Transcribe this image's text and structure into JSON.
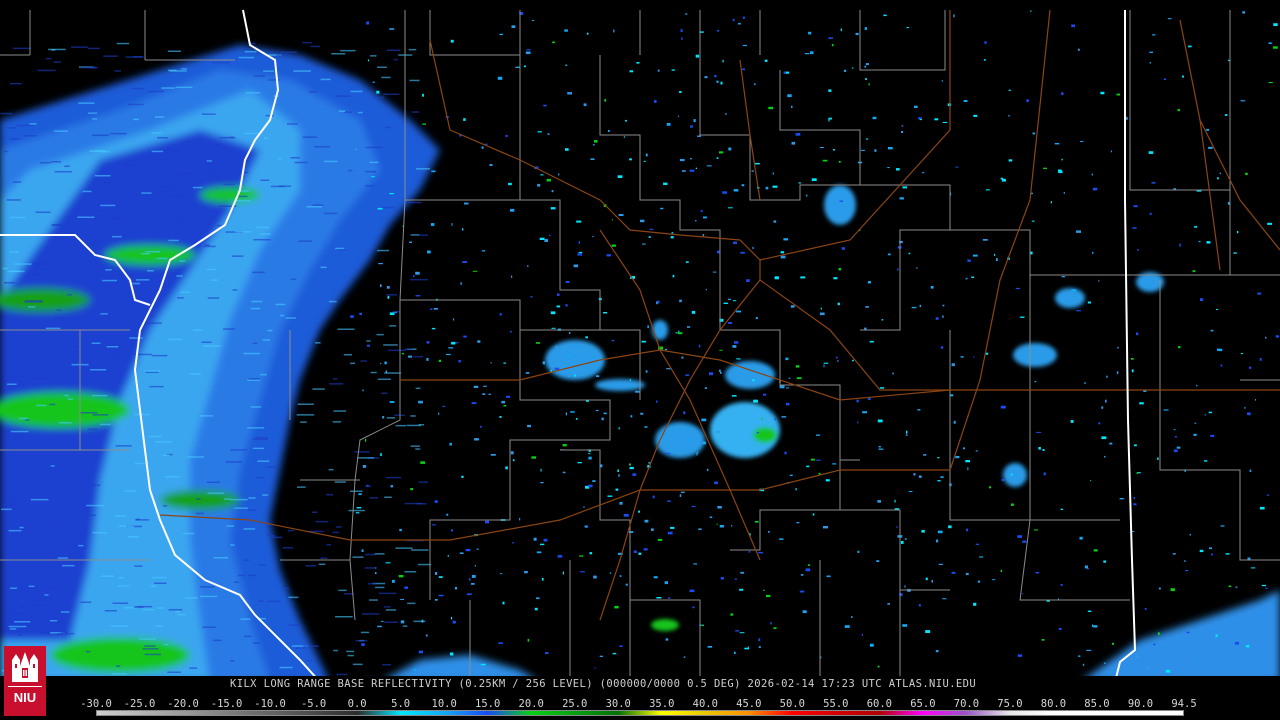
{
  "caption": "KILX LONG RANGE BASE REFLECTIVITY (0.25KM / 256 LEVEL) (000000/0000 0.5 DEG) 2026-02-14 17:23 UTC  ATLAS.NIU.EDU",
  "logo_text": "NIU",
  "scale": {
    "labels": [
      "-30.0",
      "-25.0",
      "-20.0",
      "-15.0",
      "-10.0",
      "-5.0",
      "0.0",
      "5.0",
      "10.0",
      "15.0",
      "20.0",
      "25.0",
      "30.0",
      "35.0",
      "40.0",
      "45.0",
      "50.0",
      "55.0",
      "60.0",
      "65.0",
      "70.0",
      "75.0",
      "80.0",
      "85.0",
      "90.0",
      "94.5"
    ],
    "colors": [
      "#cfcfcf",
      "#b5b5b5",
      "#9a9a9a",
      "#7e7e7e",
      "#646464",
      "#4a4a4a",
      "#2d2d2d",
      "#00e8ff",
      "#14a8f5",
      "#1a4cf2",
      "#08d014",
      "#06a010",
      "#067008",
      "#ffff00",
      "#e8c800",
      "#ff9000",
      "#ff0000",
      "#d40000",
      "#b00000",
      "#ff00ff",
      "#9a55c8",
      "#e6e6e6",
      "#ffffff",
      "#ffffff",
      "#ffffff",
      "#ffffff"
    ]
  },
  "colors": {
    "background": "#000000",
    "county_lines": "#8c8c8c",
    "state_lines": "#ffffff",
    "highways": "#8b4513"
  },
  "icons": [
    "niu-logo"
  ]
}
